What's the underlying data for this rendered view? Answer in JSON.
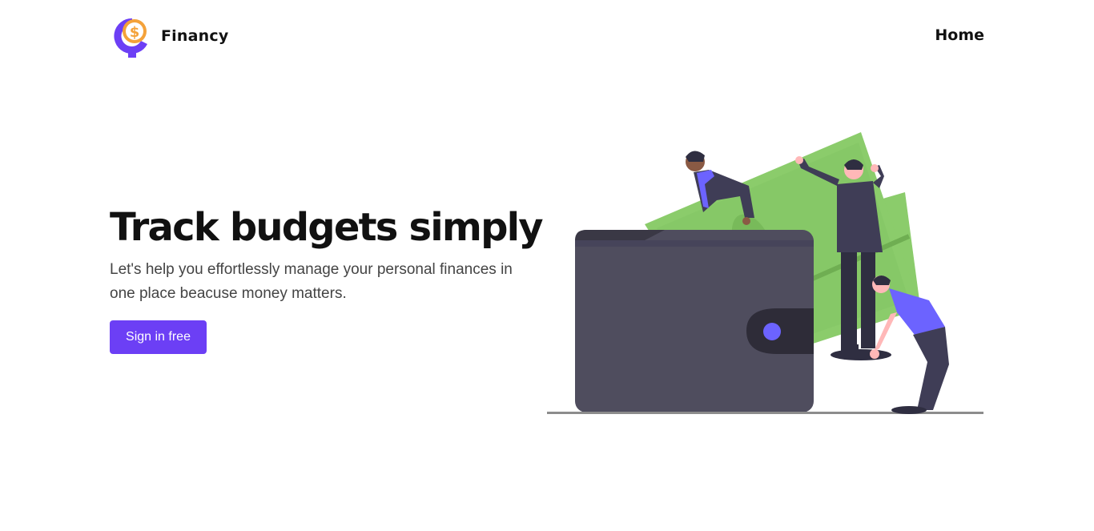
{
  "header": {
    "brand_name": "Financy",
    "logo_icon": "dollar-coin-logo-icon",
    "nav": {
      "home_label": "Home"
    }
  },
  "hero": {
    "title": "Track budgets simply",
    "subtitle": "Let's help you effortlessly manage your personal finances in one place beacuse money matters.",
    "cta_label": "Sign in free",
    "illustration_icon": "wallet-money-people-illustration"
  },
  "colors": {
    "accent": "#6c3ff5",
    "logo_orange": "#f4a23a",
    "logo_purple": "#6c3ff5",
    "money_green": "#8bcc6b",
    "wallet_gray": "#4f4d5e",
    "text_dark": "#111111",
    "text_body": "#444444"
  }
}
